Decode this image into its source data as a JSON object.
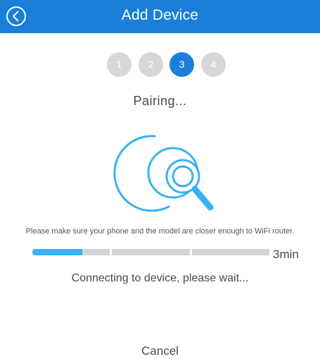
{
  "header": {
    "title": "Add Device"
  },
  "steps": [
    {
      "label": "1",
      "active": false
    },
    {
      "label": "2",
      "active": false
    },
    {
      "label": "3",
      "active": true
    },
    {
      "label": "4",
      "active": false
    }
  ],
  "status": {
    "title": "Pairing...",
    "instruction": "Please make sure your phone and the model are closer enough to WiFi router.",
    "progress_fraction": 0.21,
    "duration": "3min",
    "message": "Connecting to device, please wait..."
  },
  "actions": {
    "cancel_label": "Cancel"
  },
  "colors": {
    "primary": "#1a7fd9",
    "accent": "#3ab1f3",
    "inactive": "#d7d7d7",
    "text": "#4a4a4a"
  }
}
